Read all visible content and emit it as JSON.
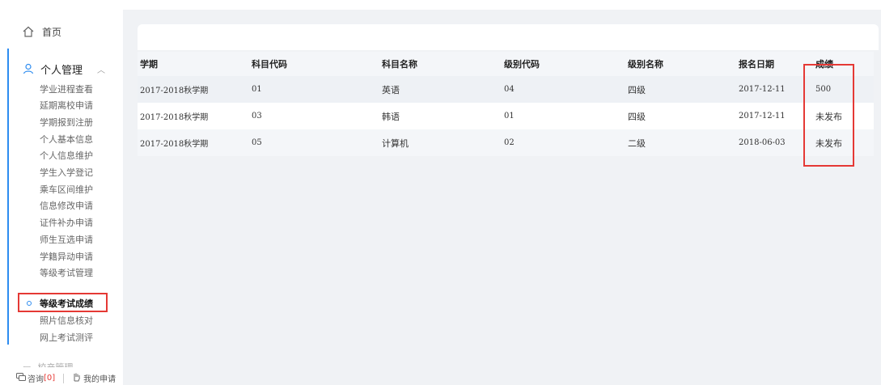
{
  "sidebar": {
    "home_label": "首页",
    "group_label": "个人管理",
    "items": [
      {
        "label": "学业进程查看"
      },
      {
        "label": "延期离校申请"
      },
      {
        "label": "学期报到注册"
      },
      {
        "label": "个人基本信息"
      },
      {
        "label": "个人信息维护"
      },
      {
        "label": "学生入学登记"
      },
      {
        "label": "乘车区间维护"
      },
      {
        "label": "信息修改申请"
      },
      {
        "label": "证件补办申请"
      },
      {
        "label": "师生互选申请"
      },
      {
        "label": "学籍异动申请"
      },
      {
        "label": "等级考试管理"
      },
      {
        "label": "等级考试成绩"
      },
      {
        "label": "照片信息核对"
      },
      {
        "label": "网上考试测评"
      }
    ],
    "active_index": 12,
    "next_group_label": "校产管理",
    "footer": {
      "consult_label": "咨询",
      "consult_count": "[0]",
      "my_apply_label": "我的申请"
    }
  },
  "table": {
    "headers": [
      "学期",
      "科目代码",
      "科目名称",
      "级别代码",
      "级别名称",
      "报名日期",
      "成绩"
    ],
    "rows": [
      [
        "2017-2018秋学期",
        "01",
        "英语",
        "04",
        "四级",
        "2017-12-11",
        "500"
      ],
      [
        "2017-2018秋学期",
        "03",
        "韩语",
        "01",
        "四级",
        "2017-12-11",
        "未发布"
      ],
      [
        "2017-2018秋学期",
        "05",
        "计算机",
        "02",
        "二级",
        "2018-06-03",
        "未发布"
      ]
    ]
  },
  "colors": {
    "accent": "#2d8cf0",
    "highlight": "#e53935"
  },
  "icons": [
    "home-icon",
    "user-icon",
    "chevron-up-icon",
    "chat-icon",
    "hand-icon"
  ]
}
